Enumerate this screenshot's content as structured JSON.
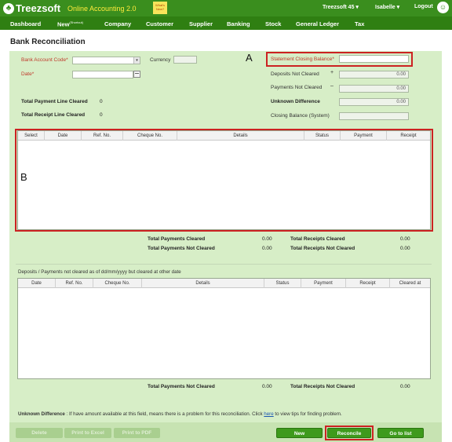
{
  "brand": {
    "logo_text": "Treezsoft",
    "app_name": "Online Accounting 2.0",
    "sticky_note": "What's New?"
  },
  "user_nav": {
    "company": "Treezsoft 45",
    "user": "Isabelle",
    "logout": "Logout"
  },
  "nav": {
    "items": [
      "Dashboard",
      "New",
      "Company",
      "Customer",
      "Supplier",
      "Banking",
      "Stock",
      "General Ledger",
      "Tax"
    ],
    "new_badge": "Shortcut"
  },
  "page": {
    "title": "Bank Reconciliation"
  },
  "form": {
    "bank_account_code": "Bank Account Code",
    "currency": "Currency",
    "date": "Date",
    "total_payment_line_cleared": "Total Payment Line Cleared",
    "total_payment_line_cleared_value": "0",
    "total_receipt_line_cleared": "Total Receipt Line Cleared",
    "total_receipt_line_cleared_value": "0",
    "statement_closing_balance": "Statement Closing Balance",
    "deposits_not_cleared": "Deposits Not Cleared",
    "deposits_not_cleared_value": "0.00",
    "payments_not_cleared": "Payments Not Cleared",
    "payments_not_cleared_value": "0.00",
    "unknown_difference": "Unknown Difference",
    "unknown_difference_value": "0.00",
    "closing_balance_system": "Closing Balance (System)",
    "plus_sign": "+",
    "minus_sign": "–"
  },
  "annotations": {
    "a": "A",
    "b": "B"
  },
  "grid1": {
    "columns": [
      "Select",
      "Date",
      "Ref. No.",
      "Cheque No.",
      "Details",
      "Status",
      "Payment",
      "Receipt"
    ]
  },
  "totals1": {
    "total_payments_cleared": "Total Payments Cleared",
    "total_payments_cleared_value": "0.00",
    "total_payments_not_cleared": "Total Payments Not Cleared",
    "total_payments_not_cleared_value": "0.00",
    "total_receipts_cleared": "Total Receipts Cleared",
    "total_receipts_cleared_value": "0.00",
    "total_receipts_not_cleared": "Total Receipts Not Cleared",
    "total_receipts_not_cleared_value": "0.00"
  },
  "section2": {
    "title": "Deposits / Payments not cleared as of dd/mm/yyyy but cleared at other date"
  },
  "grid2": {
    "columns": [
      "Date",
      "Ref. No.",
      "Cheque No.",
      "Details",
      "Status",
      "Payment",
      "Receipt",
      "Cleared at"
    ]
  },
  "totals2": {
    "total_payments_not_cleared": "Total Payments Not Cleared",
    "total_payments_not_cleared_value": "0.00",
    "total_receipts_not_cleared": "Total Receipts Not Cleared",
    "total_receipts_not_cleared_value": "0.00"
  },
  "footer_note": {
    "label": "Unknown Difference",
    "text_before": " : If have amount available at this field, means there is a problem for this reconciliation. Click ",
    "link": "here",
    "text_after": " to view tips for finding problem."
  },
  "buttons": {
    "delete": "Delete",
    "print_excel": "Print to Excel",
    "print_pdf": "Print to PDF",
    "new": "New",
    "reconcile": "Reconcile",
    "go_to_list": "Go to list"
  },
  "colors": {
    "header_green": "#3a8e1e",
    "nav_green": "#2f7f12",
    "panel_green": "#d7eec7",
    "highlight_red": "#cc2222",
    "required_red": "#c0392b"
  }
}
